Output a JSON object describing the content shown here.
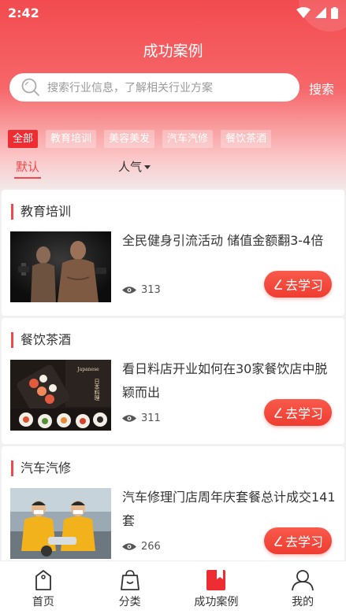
{
  "status": {
    "time": "2:42"
  },
  "header": {
    "title": "成功案例"
  },
  "search": {
    "placeholder": "搜索行业信息，了解相关行业方案",
    "button": "搜索"
  },
  "filters": [
    "全部",
    "教育培训",
    "美容美发",
    "汽车汽修",
    "餐饮茶酒"
  ],
  "active_filter": "全部",
  "sort": {
    "default": "默认",
    "popularity": "人气"
  },
  "cards": [
    {
      "category": "教育培训",
      "title": "全民健身引流活动 储值金额翻3-4倍",
      "views": "313",
      "button": "去学习"
    },
    {
      "category": "餐饮茶酒",
      "title": "看日料店开业如何在30家餐饮店中脱颖而出",
      "views": "311",
      "button": "去学习"
    },
    {
      "category": "汽车汽修",
      "title": "汽车修理门店周年庆套餐总计成交141套",
      "views": "266",
      "button": "去学习"
    }
  ],
  "image_text": {
    "food_sign": "日本料理"
  },
  "tabbar": [
    {
      "label": "首页",
      "icon": "tag-icon"
    },
    {
      "label": "分类",
      "icon": "bag-icon"
    },
    {
      "label": "成功案例",
      "icon": "bookmark-icon"
    },
    {
      "label": "我的",
      "icon": "user-icon"
    }
  ],
  "colors": {
    "accent": "#f2474b",
    "active_tab_icon": "#ee2d33"
  }
}
